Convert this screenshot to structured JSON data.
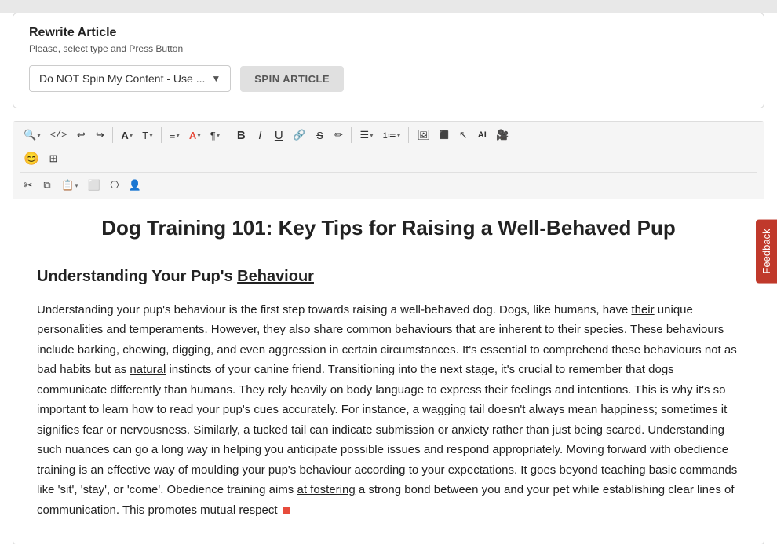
{
  "rewrite": {
    "title": "Rewrite Article",
    "subtitle": "Please, select type and Press Button",
    "dropdown_label": "Do NOT Spin My Content - Use ...",
    "button_label": "SPIN ARTICLE"
  },
  "toolbar": {
    "row1": [
      {
        "id": "search",
        "icon": "🔍",
        "has_caret": true
      },
      {
        "id": "code",
        "icon": "</>",
        "has_caret": false
      },
      {
        "id": "undo",
        "icon": "↩",
        "has_caret": false
      },
      {
        "id": "redo",
        "icon": "↪",
        "has_caret": false
      },
      {
        "id": "font",
        "icon": "A",
        "has_caret": true
      },
      {
        "id": "text-size",
        "icon": "T↕",
        "has_caret": true
      },
      {
        "id": "align",
        "icon": "≡",
        "has_caret": true
      },
      {
        "id": "color",
        "icon": "A🎨",
        "has_caret": true
      },
      {
        "id": "paragraph",
        "icon": "¶",
        "has_caret": true
      },
      {
        "id": "bold",
        "icon": "B",
        "has_caret": false
      },
      {
        "id": "italic",
        "icon": "I",
        "has_caret": false
      },
      {
        "id": "underline",
        "icon": "U",
        "has_caret": false
      },
      {
        "id": "link",
        "icon": "🔗",
        "has_caret": false
      },
      {
        "id": "strikethrough",
        "icon": "S̶",
        "has_caret": false
      },
      {
        "id": "highlight",
        "icon": "✏️",
        "has_caret": false
      },
      {
        "id": "bullet-list",
        "icon": "≔",
        "has_caret": true
      },
      {
        "id": "numbered-list",
        "icon": "1≔",
        "has_caret": true
      },
      {
        "id": "image",
        "icon": "🖼",
        "has_caret": false
      },
      {
        "id": "special",
        "icon": "⬛",
        "has_caret": false
      },
      {
        "id": "ai",
        "icon": "AI",
        "has_caret": false
      },
      {
        "id": "video",
        "icon": "🎥",
        "has_caret": false
      }
    ],
    "row2_left": [
      {
        "id": "emoji",
        "icon": "😊",
        "has_caret": false
      },
      {
        "id": "table",
        "icon": "⊞",
        "has_caret": false
      }
    ],
    "row3": [
      {
        "id": "cut",
        "icon": "✂",
        "has_caret": false
      },
      {
        "id": "copy",
        "icon": "⧉",
        "has_caret": false
      },
      {
        "id": "paste",
        "icon": "📋",
        "has_caret": true
      },
      {
        "id": "select",
        "icon": "⬜",
        "has_caret": false
      },
      {
        "id": "format",
        "icon": "⎔",
        "has_caret": false
      },
      {
        "id": "person",
        "icon": "👤",
        "has_caret": false
      }
    ]
  },
  "article": {
    "title": "Dog Training 101: Key Tips for Raising a Well-Behaved Pup",
    "section1_heading": "Understanding Your Pup's Behaviour",
    "section1_paragraph": "Understanding your pup's behaviour is the first step towards raising a well-behaved dog. Dogs, like humans, have their unique personalities and temperaments. However, they also share common behaviours that are inherent to their species. These behaviours include barking, chewing, digging, and even aggression in certain circumstances. It's essential to comprehend these behaviours not as bad habits but as natural instincts of your canine friend. Transitioning into the next stage, it's crucial to remember that dogs communicate differently than humans. They rely heavily on body language to express their feelings and intentions. This is why it's so important to learn how to read your pup's cues accurately. For instance, a wagging tail doesn't always mean happiness; sometimes it signifies fear or nervousness. Similarly, a tucked tail can indicate submission or anxiety rather than just being scared. Understanding such nuances can go a long way in helping you anticipate possible issues and respond appropriately. Moving forward with obedience training is an effective way of moulding your pup's behaviour according to your expectations. It goes beyond teaching basic commands like 'sit', 'stay', or 'come'. Obedience training aims at fostering a strong bond between you and your pet while establishing clear lines of communication. This promotes mutual respect"
  },
  "feedback_tab": "Feedback"
}
